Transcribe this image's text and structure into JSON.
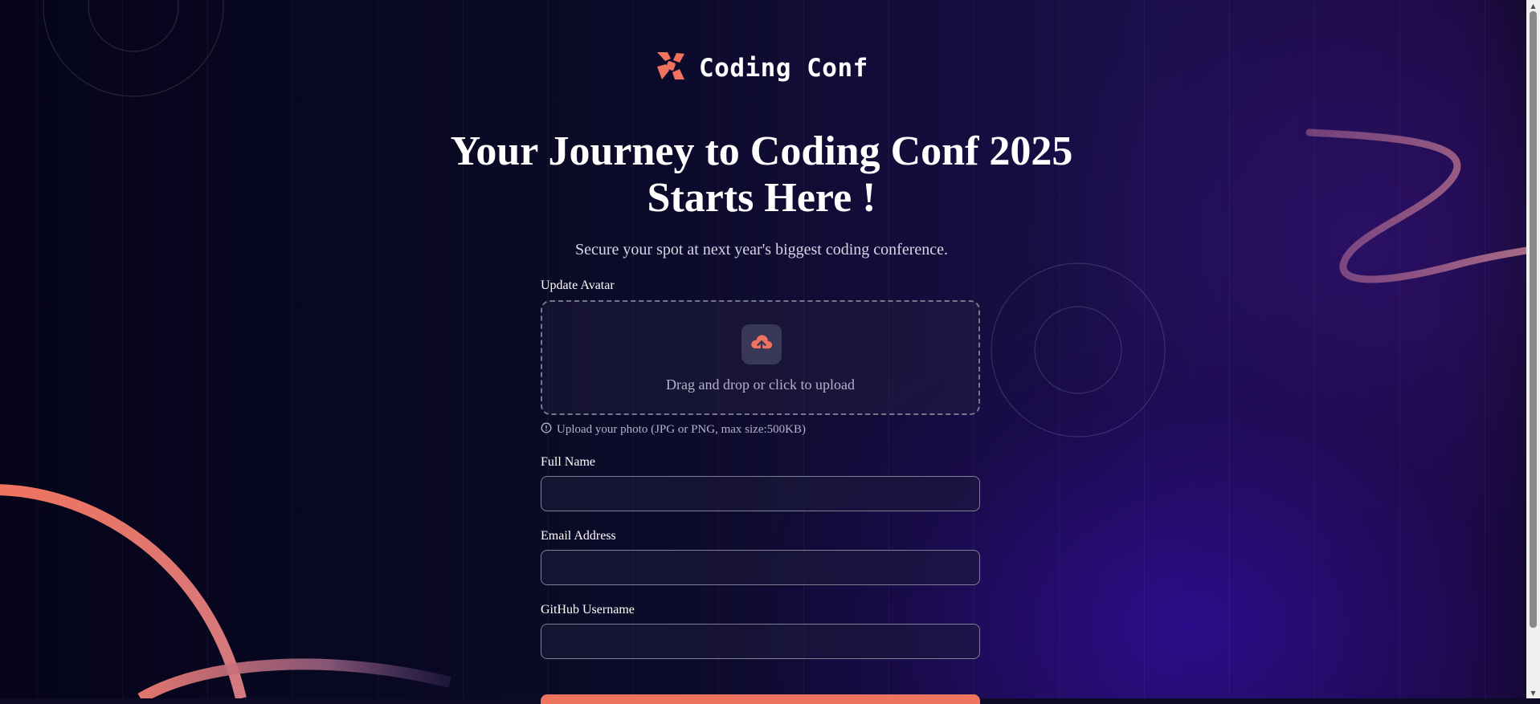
{
  "brand": {
    "name": "Coding Conf",
    "accent": "#f0735f"
  },
  "hero": {
    "title": "Your Journey to Coding Conf 2025 Starts Here !",
    "subtitle": "Secure your spot at next year's biggest coding conference."
  },
  "form": {
    "avatar_label": "Update Avatar",
    "upload_icon": "cloud-upload-icon",
    "upload_text": "Drag and drop or click to upload",
    "upload_hint_icon": "info-icon",
    "upload_hint": "Upload your photo (JPG or PNG, max size:500KB)",
    "full_name_label": "Full Name",
    "full_name_value": "",
    "email_label": "Email Address",
    "email_value": "",
    "github_label": "GitHub Username",
    "github_value": ""
  },
  "colors": {
    "background": "#0c0a24",
    "purple_glow": "#340ca0",
    "accent": "#f0735f"
  }
}
